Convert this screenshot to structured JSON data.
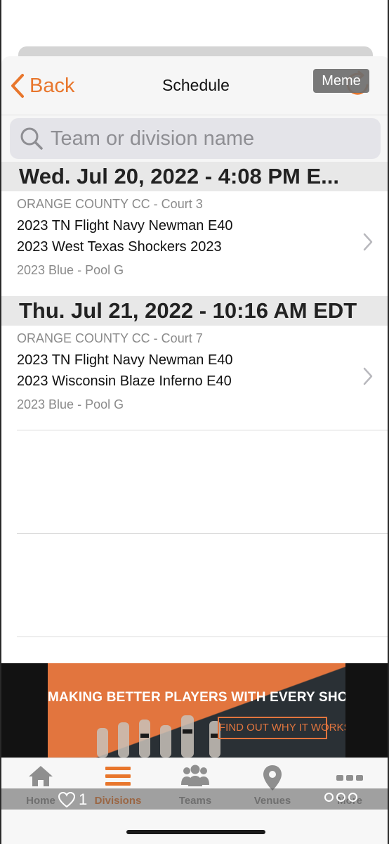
{
  "navbar": {
    "back_label": "Back",
    "title": "Schedule",
    "overlay_badge": "Meme",
    "refresh_icon": "refresh-icon"
  },
  "search": {
    "placeholder": "Team or division name",
    "value": ""
  },
  "schedule": [
    {
      "date_header": "Wed. Jul 20, 2022 - 4:08 PM E...",
      "match": {
        "venue": "ORANGE COUNTY CC - Court 3",
        "team1": "2023 TN Flight Navy Newman E40",
        "team2": "2023 West Texas Shockers 2023",
        "pool": "2023 Blue - Pool G"
      }
    },
    {
      "date_header": "Thu. Jul 21, 2022 - 10:16 AM EDT",
      "match": {
        "venue": "ORANGE COUNTY CC - Court 7",
        "team1": "2023 TN Flight Navy Newman E40",
        "team2": "2023 Wisconsin Blaze Inferno E40",
        "pool": "2023 Blue - Pool G"
      }
    }
  ],
  "ad": {
    "headline": "MAKING BETTER PLAYERS WITH EVERY SHOT",
    "cta": "FIND OUT WHY IT WORKS"
  },
  "tabbar": {
    "items": [
      {
        "label": "Home",
        "icon": "home-icon",
        "active": false
      },
      {
        "label": "Divisions",
        "icon": "list-icon",
        "active": true
      },
      {
        "label": "Teams",
        "icon": "team-icon",
        "active": false
      },
      {
        "label": "Venues",
        "icon": "map-pin-icon",
        "active": false
      },
      {
        "label": "More",
        "icon": "more-icon",
        "active": false
      }
    ]
  },
  "overlay": {
    "like_count": "1"
  },
  "colors": {
    "accent": "#e8762c",
    "section_bg": "#e8e8e8",
    "secondary_text": "#8a8a8a"
  }
}
